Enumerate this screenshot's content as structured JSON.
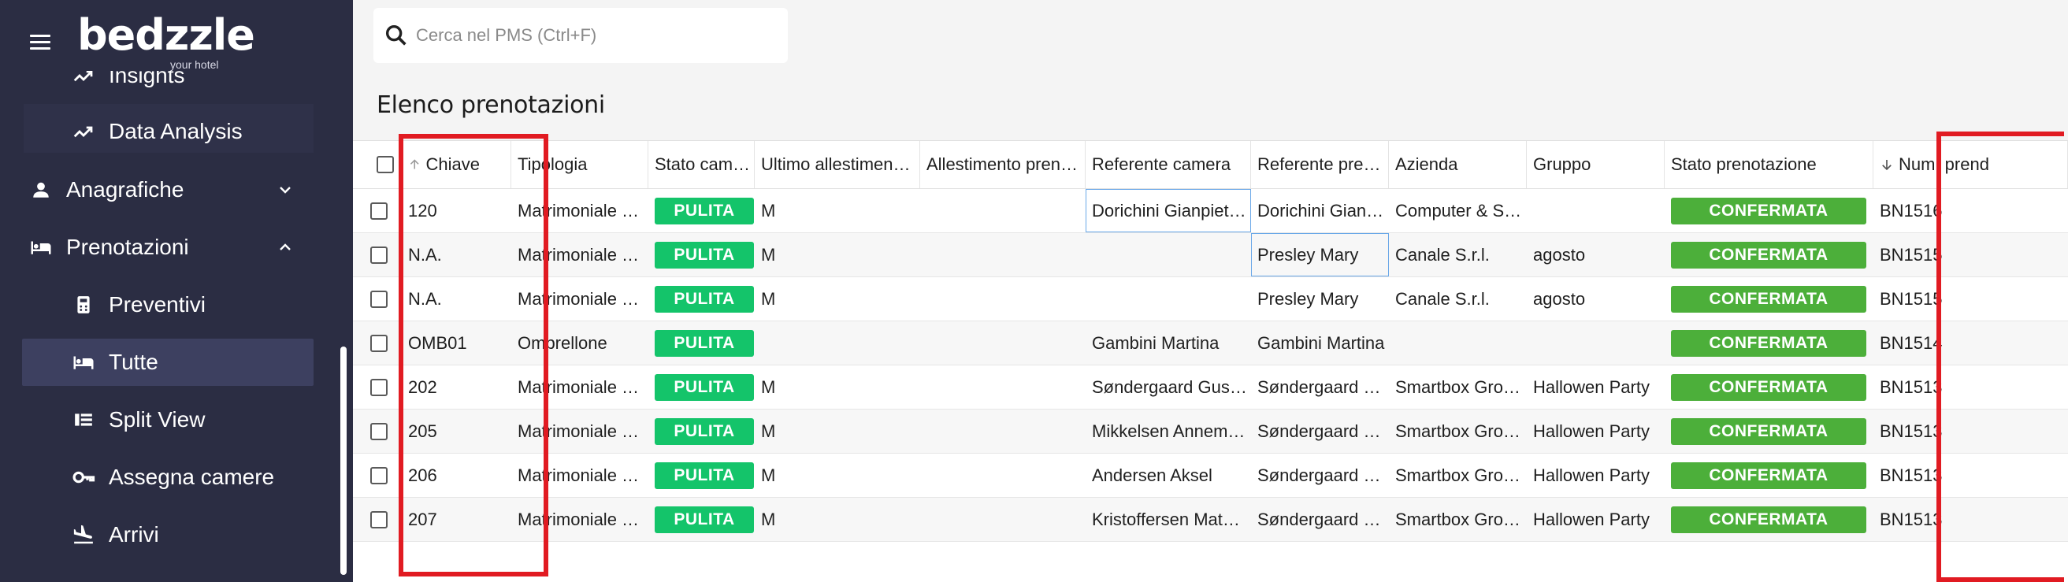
{
  "app": {
    "logo_text": "bedzzle",
    "logo_tagline": "your hotel"
  },
  "sidebar": {
    "items": [
      {
        "label": "Insights",
        "icon": "trending-icon",
        "level": "sub"
      },
      {
        "label": "Data Analysis",
        "icon": "trending-icon",
        "level": "sub"
      },
      {
        "label": "Anagrafiche",
        "icon": "person-icon",
        "level": "top",
        "expanded": false
      },
      {
        "label": "Prenotazioni",
        "icon": "bed-icon",
        "level": "top",
        "expanded": true
      },
      {
        "label": "Preventivi",
        "icon": "calculator-icon",
        "level": "sub"
      },
      {
        "label": "Tutte",
        "icon": "bed-icon",
        "level": "sub",
        "active": true
      },
      {
        "label": "Split View",
        "icon": "split-view-icon",
        "level": "sub"
      },
      {
        "label": "Assegna camere",
        "icon": "key-icon",
        "level": "sub"
      },
      {
        "label": "Arrivi",
        "icon": "flight-land-icon",
        "level": "sub"
      }
    ]
  },
  "search": {
    "placeholder": "Cerca nel PMS (Ctrl+F)"
  },
  "page": {
    "title": "Elenco prenotazioni"
  },
  "table": {
    "columns": [
      {
        "key": "chiave",
        "label": "Chiave",
        "sort": "asc"
      },
      {
        "key": "tipologia",
        "label": "Tipologia"
      },
      {
        "key": "stato_camera",
        "label": "Stato cam…"
      },
      {
        "key": "ultimo_allestimento",
        "label": "Ultimo allestimen…"
      },
      {
        "key": "allestimento_pren",
        "label": "Allestimento pren…"
      },
      {
        "key": "referente_camera",
        "label": "Referente camera"
      },
      {
        "key": "referente_prenot",
        "label": "Referente prenot…"
      },
      {
        "key": "azienda",
        "label": "Azienda"
      },
      {
        "key": "gruppo",
        "label": "Gruppo"
      },
      {
        "key": "stato_prenotazione",
        "label": "Stato prenotazione"
      },
      {
        "key": "num_pren",
        "label": "Num. prend",
        "sort": "desc"
      }
    ],
    "rows": [
      {
        "chiave": "120",
        "tipologia": "Matrimoniale …",
        "stato_camera": "PULITA",
        "ultimo_allestimento": "M",
        "allestimento_pren": "",
        "referente_camera": "Dorichini Gianpiet…",
        "referente_prenot": "Dorichini Gianpiet…",
        "azienda": "Computer & S…",
        "gruppo": "",
        "stato_prenotazione": "CONFERMATA",
        "num_pren": "BN1516"
      },
      {
        "chiave": "N.A.",
        "tipologia": "Matrimoniale …",
        "stato_camera": "PULITA",
        "ultimo_allestimento": "M",
        "allestimento_pren": "",
        "referente_camera": "",
        "referente_prenot": "Presley Mary",
        "azienda": "Canale S.r.l.",
        "gruppo": "agosto",
        "stato_prenotazione": "CONFERMATA",
        "num_pren": "BN1515"
      },
      {
        "chiave": "N.A.",
        "tipologia": "Matrimoniale …",
        "stato_camera": "PULITA",
        "ultimo_allestimento": "M",
        "allestimento_pren": "",
        "referente_camera": "",
        "referente_prenot": "Presley Mary",
        "azienda": "Canale S.r.l.",
        "gruppo": "agosto",
        "stato_prenotazione": "CONFERMATA",
        "num_pren": "BN1515"
      },
      {
        "chiave": "OMB01",
        "tipologia": "Ombrellone",
        "stato_camera": "PULITA",
        "ultimo_allestimento": "",
        "allestimento_pren": "",
        "referente_camera": "Gambini Martina",
        "referente_prenot": "Gambini Martina",
        "azienda": "",
        "gruppo": "",
        "stato_prenotazione": "CONFERMATA",
        "num_pren": "BN1514"
      },
      {
        "chiave": "202",
        "tipologia": "Matrimoniale …",
        "stato_camera": "PULITA",
        "ultimo_allestimento": "M",
        "allestimento_pren": "",
        "referente_camera": "Søndergaard Gus…",
        "referente_prenot": "Søndergaard Gus…",
        "azienda": "Smartbox Gro…",
        "gruppo": "Hallowen Party",
        "stato_prenotazione": "CONFERMATA",
        "num_pren": "BN1513"
      },
      {
        "chiave": "205",
        "tipologia": "Matrimoniale …",
        "stato_camera": "PULITA",
        "ultimo_allestimento": "M",
        "allestimento_pren": "",
        "referente_camera": "Mikkelsen Annem…",
        "referente_prenot": "Søndergaard Gus…",
        "azienda": "Smartbox Gro…",
        "gruppo": "Hallowen Party",
        "stato_prenotazione": "CONFERMATA",
        "num_pren": "BN1513"
      },
      {
        "chiave": "206",
        "tipologia": "Matrimoniale …",
        "stato_camera": "PULITA",
        "ultimo_allestimento": "M",
        "allestimento_pren": "",
        "referente_camera": "Andersen Aksel",
        "referente_prenot": "Søndergaard Gus…",
        "azienda": "Smartbox Gro…",
        "gruppo": "Hallowen Party",
        "stato_prenotazione": "CONFERMATA",
        "num_pren": "BN1513"
      },
      {
        "chiave": "207",
        "tipologia": "Matrimoniale …",
        "stato_camera": "PULITA",
        "ultimo_allestimento": "M",
        "allestimento_pren": "",
        "referente_camera": "Kristoffersen Mat…",
        "referente_prenot": "Søndergaard Gus…",
        "azienda": "Smartbox Gro…",
        "gruppo": "Hallowen Party",
        "stato_prenotazione": "CONFERMATA",
        "num_pren": "BN1513"
      }
    ]
  },
  "colors": {
    "sidebar_bg": "#2b2d43",
    "badge_pulita": "#14c46a",
    "badge_confermata": "#4caf3a",
    "highlight": "#e11b22"
  }
}
